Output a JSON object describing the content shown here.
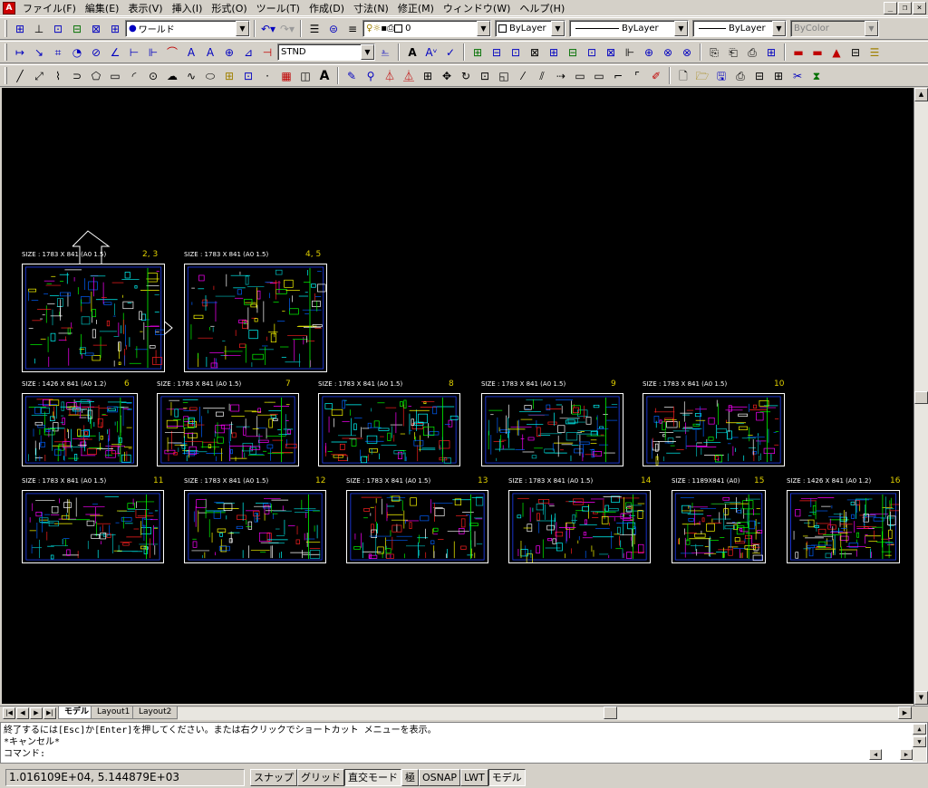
{
  "menubar": {
    "items": [
      "ファイル(F)",
      "編集(E)",
      "表示(V)",
      "挿入(I)",
      "形式(O)",
      "ツール(T)",
      "作成(D)",
      "寸法(N)",
      "修正(M)",
      "ウィンドウ(W)",
      "ヘルプ(H)"
    ],
    "window_controls": [
      "_",
      "❐",
      "×"
    ]
  },
  "toolbar1": {
    "ucs_combo": "ワールド",
    "layer_combo": "0",
    "color_combo": "ByLayer",
    "linetype_combo": "ByLayer",
    "lineweight_combo": "ByLayer",
    "plotstyle_combo": "ByColor"
  },
  "toolbar2": {
    "dimstyle_combo": "STND"
  },
  "sheets": [
    {
      "size": "SIZE : 1783 X 841 (A0 1.5)",
      "num": "2, 3"
    },
    {
      "size": "SIZE : 1783 X 841 (A0 1.5)",
      "num": "4, 5"
    },
    {
      "size": "SIZE : 1426 X 841 (A0 1.2)",
      "num": "6"
    },
    {
      "size": "SIZE : 1783 X 841 (A0 1.5)",
      "num": "7"
    },
    {
      "size": "SIZE : 1783 X 841 (A0 1.5)",
      "num": "8"
    },
    {
      "size": "SIZE : 1783 X 841 (A0 1.5)",
      "num": "9"
    },
    {
      "size": "SIZE : 1783 X 841 (A0 1.5)",
      "num": "10"
    },
    {
      "size": "SIZE : 1783 X 841 (A0 1.5)",
      "num": "11"
    },
    {
      "size": "SIZE : 1783 X 841 (A0 1.5)",
      "num": "12"
    },
    {
      "size": "SIZE : 1783 X 841 (A0 1.5)",
      "num": "13"
    },
    {
      "size": "SIZE : 1783 X 841 (A0 1.5)",
      "num": "14"
    },
    {
      "size": "SIZE : 1189X841 (A0)",
      "num": "15"
    },
    {
      "size": "SIZE : 1426 X 841 (A0 1.2)",
      "num": "16"
    }
  ],
  "tabs": [
    "モデル",
    "Layout1",
    "Layout2"
  ],
  "command": {
    "line1": "終了するには[Esc]か[Enter]を押してください。または右クリックでショートカット メニューを表示。",
    "line2": "*キャンセル*",
    "prompt": "コマンド:"
  },
  "status": {
    "coords": "1.016109E+04, 5.144879E+03",
    "buttons": [
      "スナップ",
      "グリッド",
      "直交モード",
      "極",
      "OSNAP",
      "LWT",
      "モデル"
    ]
  }
}
